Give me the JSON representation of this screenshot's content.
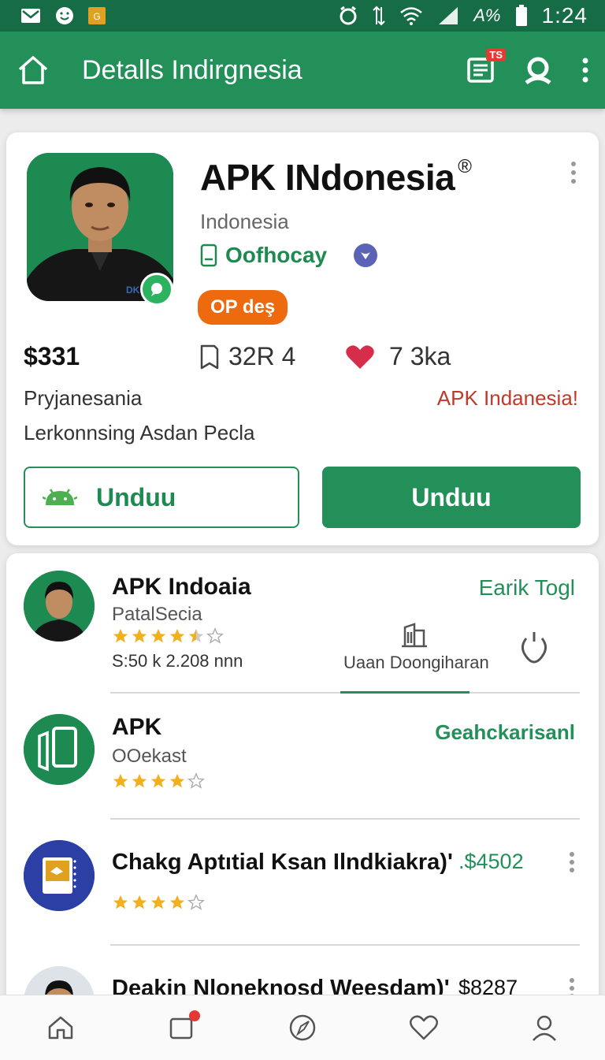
{
  "status_bar": {
    "time": "1:24",
    "battery_text": "A%"
  },
  "app_bar": {
    "title": "Detalls Indirgnesia",
    "notification_badge": "TS"
  },
  "hero": {
    "title": "APK INdonesia",
    "trademark": "®",
    "subtitle": "Indonesia",
    "developer": "Oofhocay",
    "badge": "OP deş",
    "price": "$331",
    "downloads": "32R 4",
    "likes": "7 3ka",
    "desc_line1": "Pryjanesania",
    "desc_right": "APK Indanesia!",
    "desc_line2": "Lerkonnsing Asdan Pecla",
    "btn_outline_label": "Unduu",
    "btn_filled_label": "Unduu"
  },
  "list": {
    "items": [
      {
        "title": "APK Indoaia",
        "subtitle": "PatalSecia",
        "rating": 3.5,
        "meta": "S:50  k  2.208 nnn",
        "right": "Earik Togl",
        "action_label": "Uaan Doongiharan"
      },
      {
        "title": "APK",
        "subtitle": "OOekast",
        "rating": 4,
        "right": "Geahckarisanl"
      },
      {
        "title": "Chakg Aptıtial Ksan Ilndkiakra)'",
        "price": ".$4502",
        "rating": 4
      },
      {
        "title": "Deakin Nloneknosd Weesdam)'",
        "price": "$8287"
      }
    ]
  },
  "colors": {
    "primary": "#229058",
    "primary_dark": "#156c45",
    "accent_orange": "#ee6a0e",
    "heart": "#d62d4a",
    "star": "#f2b01e"
  }
}
